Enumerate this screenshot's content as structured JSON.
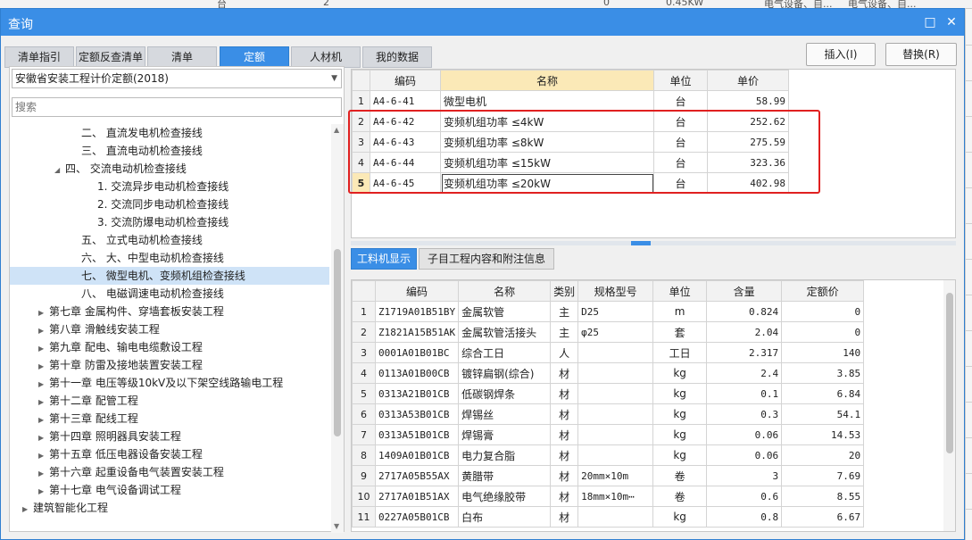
{
  "background": {
    "strip_texts": [
      "台",
      "2",
      "0",
      "0.45KW",
      "电气设备、自...",
      "电气设备、自..."
    ]
  },
  "window": {
    "title": "查询",
    "maximize_glyph": "□",
    "close_glyph": "✕"
  },
  "tabs": [
    {
      "label": "清单指引",
      "active": false
    },
    {
      "label": "定额反查清单",
      "active": false
    },
    {
      "label": "清单",
      "active": false
    },
    {
      "label": "定额",
      "active": true
    },
    {
      "label": "人材机",
      "active": false
    },
    {
      "label": "我的数据",
      "active": false
    }
  ],
  "actions": {
    "insert": "插入(I)",
    "replace": "替换(R)"
  },
  "left": {
    "quota_select": "安徽省安装工程计价定额(2018)",
    "search_placeholder": "搜索",
    "tree": [
      {
        "label": "二、 直流发电机检查接线",
        "indent": 4,
        "arrow": ""
      },
      {
        "label": "三、 直流电动机检查接线",
        "indent": 4,
        "arrow": ""
      },
      {
        "label": "四、 交流电动机检查接线",
        "indent": 3,
        "arrow": "◢"
      },
      {
        "label": "1. 交流异步电动机检查接线",
        "indent": 5,
        "arrow": ""
      },
      {
        "label": "2. 交流同步电动机检查接线",
        "indent": 5,
        "arrow": ""
      },
      {
        "label": "3. 交流防爆电动机检查接线",
        "indent": 5,
        "arrow": ""
      },
      {
        "label": "五、 立式电动机检查接线",
        "indent": 4,
        "arrow": ""
      },
      {
        "label": "六、 大、中型电动机检查接线",
        "indent": 4,
        "arrow": ""
      },
      {
        "label": "七、 微型电机、变频机组检查接线",
        "indent": 4,
        "arrow": "",
        "selected": true
      },
      {
        "label": "八、 电磁调速电动机检查接线",
        "indent": 4,
        "arrow": ""
      },
      {
        "label": "第七章 金属构件、穿墙套板安装工程",
        "indent": 2,
        "arrow": "▶"
      },
      {
        "label": "第八章 滑触线安装工程",
        "indent": 2,
        "arrow": "▶"
      },
      {
        "label": "第九章 配电、输电电缆敷设工程",
        "indent": 2,
        "arrow": "▶"
      },
      {
        "label": "第十章 防雷及接地装置安装工程",
        "indent": 2,
        "arrow": "▶"
      },
      {
        "label": "第十一章 电压等级10kV及以下架空线路输电工程",
        "indent": 2,
        "arrow": "▶"
      },
      {
        "label": "第十二章 配管工程",
        "indent": 2,
        "arrow": "▶"
      },
      {
        "label": "第十三章 配线工程",
        "indent": 2,
        "arrow": "▶"
      },
      {
        "label": "第十四章 照明器具安装工程",
        "indent": 2,
        "arrow": "▶"
      },
      {
        "label": "第十五章 低压电器设备安装工程",
        "indent": 2,
        "arrow": "▶"
      },
      {
        "label": "第十六章 起重设备电气装置安装工程",
        "indent": 2,
        "arrow": "▶"
      },
      {
        "label": "第十七章 电气设备调试工程",
        "indent": 2,
        "arrow": "▶"
      },
      {
        "label": "建筑智能化工程",
        "indent": 1,
        "arrow": "▶"
      }
    ]
  },
  "quota_table": {
    "headers": [
      "编码",
      "名称",
      "单位",
      "单价"
    ],
    "rows": [
      {
        "no": "1",
        "code": "A4-6-41",
        "name": "微型电机",
        "unit": "台",
        "price": "58.99"
      },
      {
        "no": "2",
        "code": "A4-6-42",
        "name": "变频机组功率 ≤4kW",
        "unit": "台",
        "price": "252.62"
      },
      {
        "no": "3",
        "code": "A4-6-43",
        "name": "变频机组功率 ≤8kW",
        "unit": "台",
        "price": "275.59"
      },
      {
        "no": "4",
        "code": "A4-6-44",
        "name": "变频机组功率 ≤15kW",
        "unit": "台",
        "price": "323.36"
      },
      {
        "no": "5",
        "code": "A4-6-45",
        "name": "变频机组功率 ≤20kW",
        "unit": "台",
        "price": "402.98"
      }
    ]
  },
  "bottom_tabs": [
    {
      "label": "工料机显示",
      "active": true
    },
    {
      "label": "子目工程内容和附注信息",
      "active": false
    }
  ],
  "resource_table": {
    "headers": [
      "编码",
      "名称",
      "类别",
      "规格型号",
      "单位",
      "含量",
      "定额价"
    ],
    "rows": [
      {
        "no": "1",
        "code": "Z1719A01B51BY",
        "name": "金属软管",
        "cat": "主",
        "spec": "D25",
        "unit": "m",
        "qty": "0.824",
        "price": "0"
      },
      {
        "no": "2",
        "code": "Z1821A15B51AK",
        "name": "金属软管活接头",
        "cat": "主",
        "spec": "φ25",
        "unit": "套",
        "qty": "2.04",
        "price": "0"
      },
      {
        "no": "3",
        "code": "0001A01B01BC",
        "name": "综合工日",
        "cat": "人",
        "spec": "",
        "unit": "工日",
        "qty": "2.317",
        "price": "140"
      },
      {
        "no": "4",
        "code": "0113A01B00CB",
        "name": "镀锌扁钢(综合)",
        "cat": "材",
        "spec": "",
        "unit": "kg",
        "qty": "2.4",
        "price": "3.85"
      },
      {
        "no": "5",
        "code": "0313A21B01CB",
        "name": "低碳钢焊条",
        "cat": "材",
        "spec": "",
        "unit": "kg",
        "qty": "0.1",
        "price": "6.84"
      },
      {
        "no": "6",
        "code": "0313A53B01CB",
        "name": "焊锡丝",
        "cat": "材",
        "spec": "",
        "unit": "kg",
        "qty": "0.3",
        "price": "54.1"
      },
      {
        "no": "7",
        "code": "0313A51B01CB",
        "name": "焊锡膏",
        "cat": "材",
        "spec": "",
        "unit": "kg",
        "qty": "0.06",
        "price": "14.53"
      },
      {
        "no": "8",
        "code": "1409A01B01CB",
        "name": "电力复合脂",
        "cat": "材",
        "spec": "",
        "unit": "kg",
        "qty": "0.06",
        "price": "20"
      },
      {
        "no": "9",
        "code": "2717A05B55AX",
        "name": "黄腊带",
        "cat": "材",
        "spec": "20mm×10m",
        "unit": "卷",
        "qty": "3",
        "price": "7.69"
      },
      {
        "no": "10",
        "code": "2717A01B51AX",
        "name": "电气绝缘胶带",
        "cat": "材",
        "spec": "18mm×10m⋯",
        "unit": "卷",
        "qty": "0.6",
        "price": "8.55"
      },
      {
        "no": "11",
        "code": "0227A05B01CB",
        "name": "白布",
        "cat": "材",
        "spec": "",
        "unit": "kg",
        "qty": "0.8",
        "price": "6.67"
      }
    ]
  }
}
